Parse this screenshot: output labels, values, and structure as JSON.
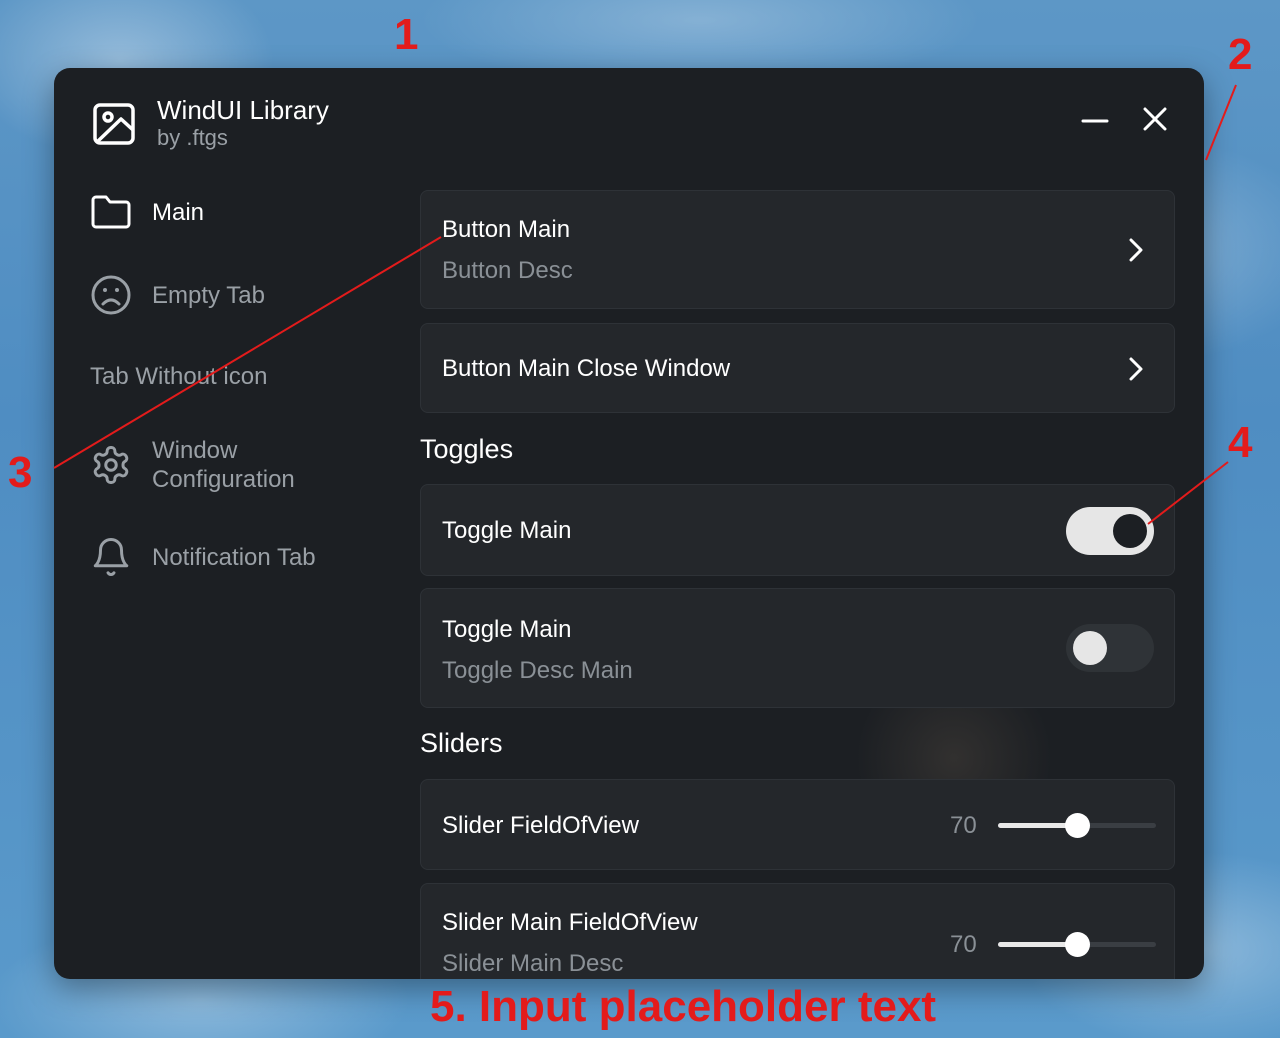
{
  "window": {
    "title": "WindUI Library",
    "subtitle": "by .ftgs",
    "icons": {
      "app": "image-icon",
      "minimize": "minimize-icon",
      "close": "close-icon"
    }
  },
  "sidebar": {
    "items": [
      {
        "label": "Main",
        "icon": "folder-icon",
        "active": true
      },
      {
        "label": "Empty Tab",
        "icon": "frown-icon"
      },
      {
        "label": "Tab Without icon"
      },
      {
        "label": "Window Configuration",
        "line1": "Window",
        "line2": "Configuration",
        "icon": "gear-icon"
      },
      {
        "label": "Notification Tab",
        "icon": "bell-icon"
      }
    ]
  },
  "main": {
    "buttons": [
      {
        "title": "Button Main",
        "desc": "Button Desc"
      },
      {
        "title": "Button Main Close Window"
      }
    ],
    "toggles_header": "Toggles",
    "toggles": [
      {
        "title": "Toggle Main",
        "on": true
      },
      {
        "title": "Toggle Main",
        "desc": "Toggle Desc Main",
        "on": false
      }
    ],
    "sliders_header": "Sliders",
    "sliders": [
      {
        "title": "Slider FieldOfView",
        "value": "70",
        "fraction": 0.5
      },
      {
        "title": "Slider Main FieldOfView",
        "desc": "Slider Main Desc",
        "value": "70",
        "fraction": 0.5
      }
    ]
  },
  "annotations": {
    "labels": [
      "1",
      "2",
      "3",
      "4"
    ],
    "caption": "5. Input placeholder text",
    "color": "#e31b1b"
  },
  "colors": {
    "window_bg": "#1c1f23",
    "card_bg": "#24272b",
    "muted_text": "#9aa0a6"
  }
}
